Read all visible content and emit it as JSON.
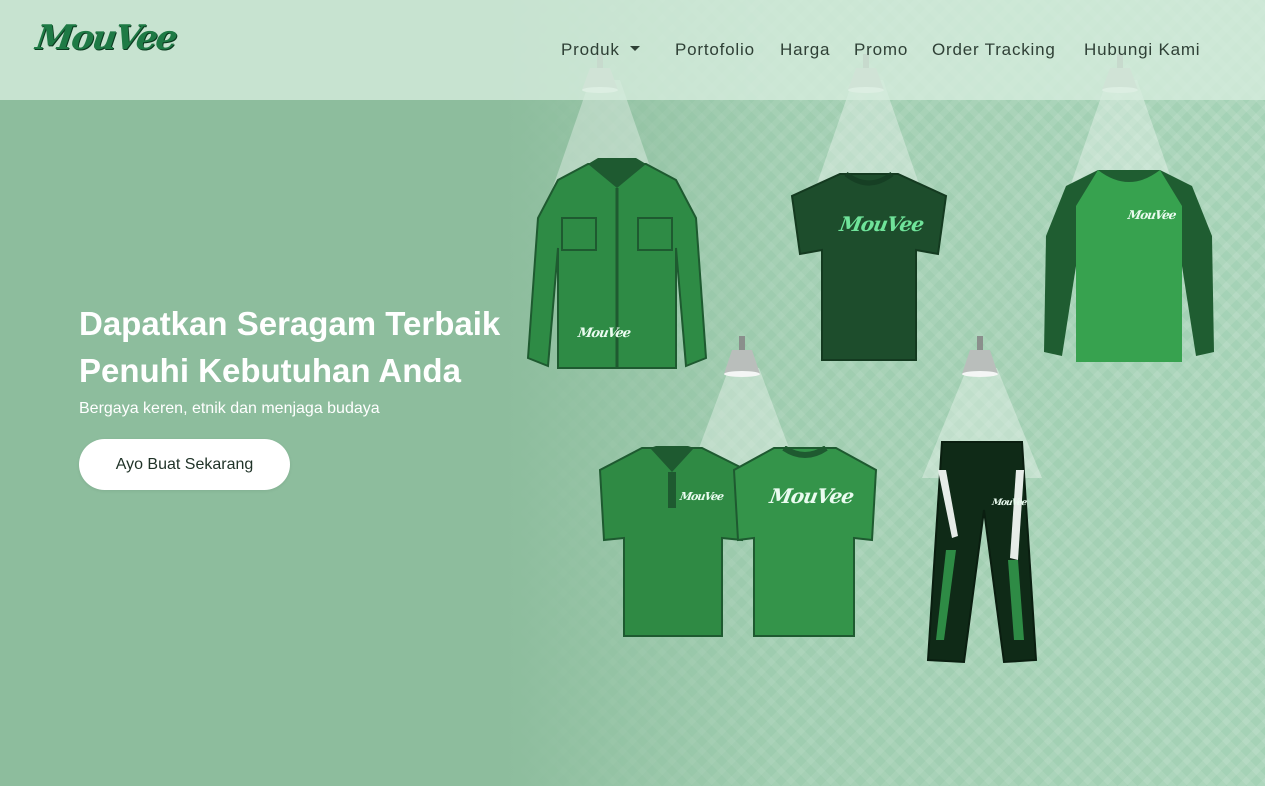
{
  "brand": {
    "logo_text": "MouVee"
  },
  "nav": {
    "items": [
      {
        "label": "Produk",
        "has_dropdown": true
      },
      {
        "label": "Portofolio"
      },
      {
        "label": "Harga"
      },
      {
        "label": "Promo"
      },
      {
        "label": "Order Tracking"
      },
      {
        "label": "Hubungi Kami"
      }
    ]
  },
  "hero": {
    "headline_line1": "Dapatkan Seragam Terbaik",
    "headline_line2": "Penuhi Kebutuhan Anda",
    "subheadline": "Bergaya keren, etnik dan menjaga budaya",
    "cta_label": "Ayo Buat Sekarang"
  },
  "products": {
    "garment_logo": "MouVee",
    "items": [
      "long-sleeve-shirt",
      "t-shirt",
      "raglan-long-sleeve",
      "polo-shirt",
      "track-pants"
    ]
  },
  "colors": {
    "accent_green": "#2e8b45",
    "dark_green": "#1e5a30",
    "background": "#a5d2b6",
    "text_dark": "#2f4036"
  }
}
